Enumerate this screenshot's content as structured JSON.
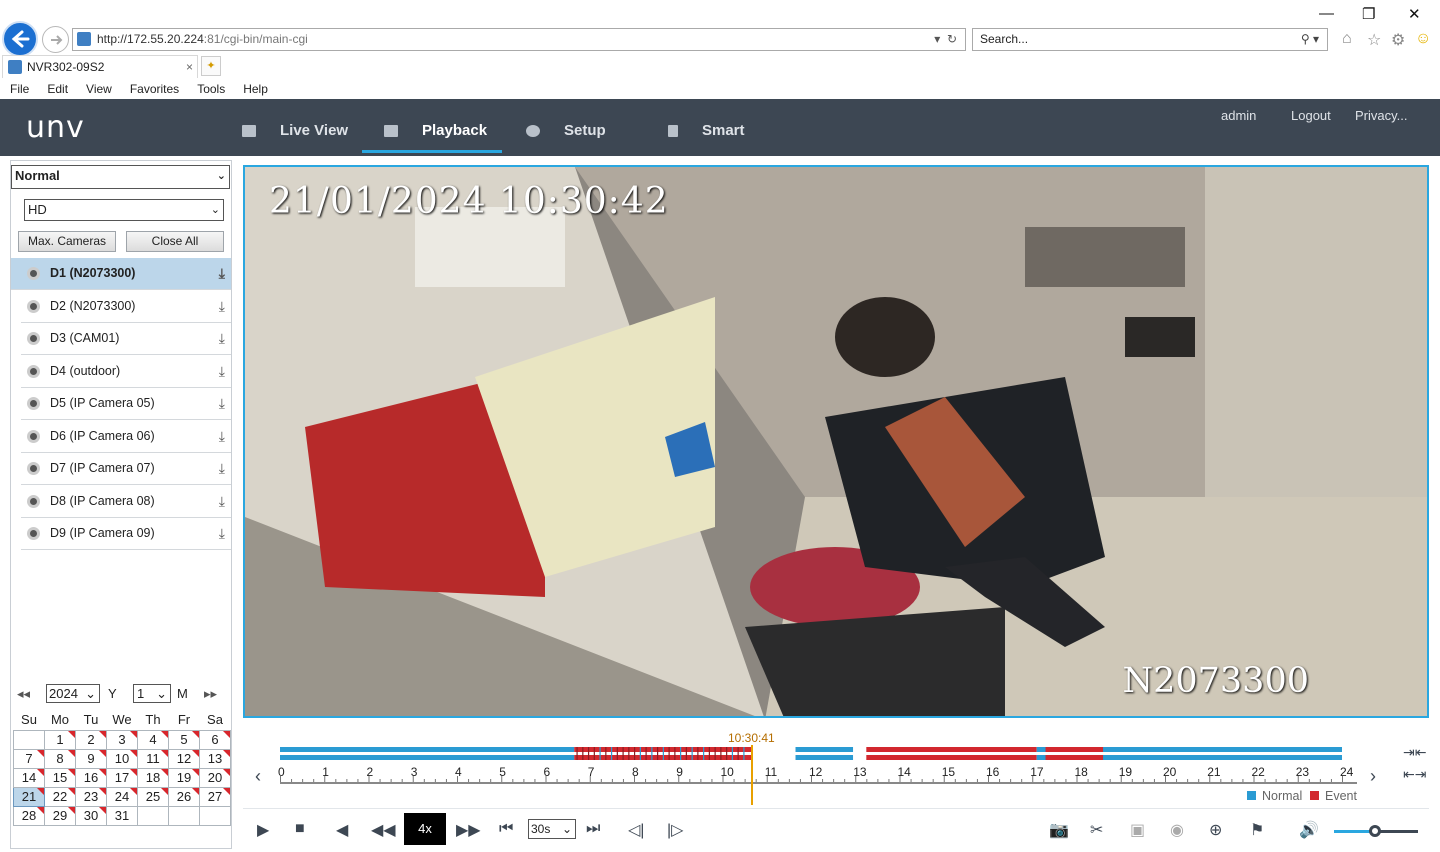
{
  "browser": {
    "url_host": "http://172.55.20.224",
    "url_path": ":81/cgi-bin/main-cgi",
    "search_placeholder": "Search...",
    "tab_title": "NVR302-09S2",
    "tab_close": "×",
    "menu": [
      "File",
      "Edit",
      "View",
      "Favorites",
      "Tools",
      "Help"
    ]
  },
  "app": {
    "logo": "unv",
    "nav": [
      {
        "label": "Live View",
        "icon": "monitor-icon"
      },
      {
        "label": "Playback",
        "icon": "film-icon",
        "active": true
      },
      {
        "label": "Setup",
        "icon": "gear-icon"
      },
      {
        "label": "Smart",
        "icon": "person-icon"
      }
    ],
    "user": "admin",
    "logout": "Logout",
    "privacy": "Privacy..."
  },
  "left_panel": {
    "mode": "Normal",
    "stream": "HD",
    "max_cameras": "Max. Cameras",
    "close_all": "Close All",
    "cameras": [
      {
        "label": "D1 (N2073300)",
        "selected": true
      },
      {
        "label": "D2 (N2073300)",
        "selected": false
      },
      {
        "label": "D3 (CAM01)",
        "selected": false
      },
      {
        "label": "D4 (outdoor)",
        "selected": false
      },
      {
        "label": "D5 (IP Camera 05)",
        "selected": false
      },
      {
        "label": "D6 (IP Camera 06)",
        "selected": false
      },
      {
        "label": "D7 (IP Camera 07)",
        "selected": false
      },
      {
        "label": "D8 (IP Camera 08)",
        "selected": false
      },
      {
        "label": "D9 (IP Camera 09)",
        "selected": false
      }
    ]
  },
  "calendar": {
    "year": "2024",
    "year_label": "Y",
    "month": "1",
    "month_label": "M",
    "weekdays": [
      "Su",
      "Mo",
      "Tu",
      "We",
      "Th",
      "Fr",
      "Sa"
    ],
    "selected_day": 21
  },
  "video": {
    "timestamp": "21/01/2024  10:30:42",
    "camera_name": "N2073300"
  },
  "timeline": {
    "cursor_time": "10:30:41",
    "hours": [
      "0",
      "1",
      "2",
      "3",
      "4",
      "5",
      "6",
      "7",
      "8",
      "9",
      "10",
      "11",
      "12",
      "13",
      "14",
      "15",
      "16",
      "17",
      "18",
      "19",
      "20",
      "21",
      "22",
      "23",
      "24"
    ],
    "legend_normal": "Normal",
    "legend_event": "Event",
    "colors": {
      "normal": "#2a9bd3",
      "event": "#d2282e",
      "cursor": "#e8a000"
    }
  },
  "controls": {
    "speed": "4x",
    "interval": "30s"
  }
}
